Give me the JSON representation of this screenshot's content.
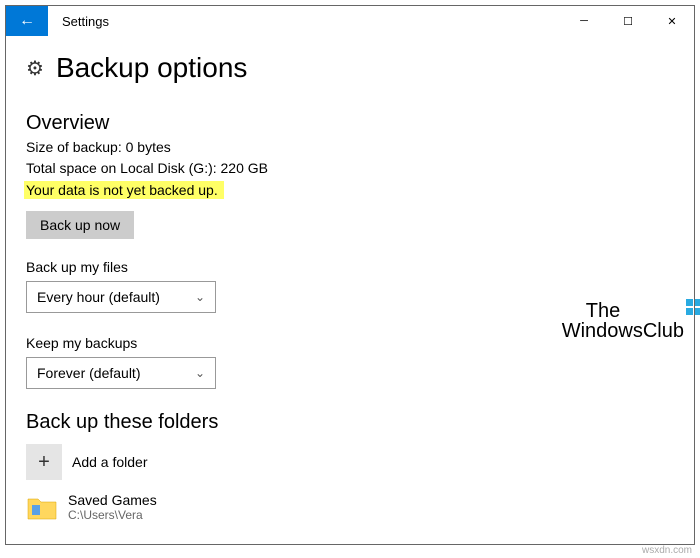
{
  "window": {
    "title": "Settings"
  },
  "header": {
    "page_title": "Backup options"
  },
  "overview": {
    "heading": "Overview",
    "size_line": "Size of backup: 0 bytes",
    "space_line": "Total space on Local Disk (G:): 220 GB",
    "status_highlight": "Your data is not yet backed up.",
    "backup_now_label": "Back up now"
  },
  "frequency": {
    "label": "Back up my files",
    "selected": "Every hour (default)"
  },
  "retention": {
    "label": "Keep my backups",
    "selected": "Forever (default)"
  },
  "folders": {
    "heading": "Back up these folders",
    "add_label": "Add a folder",
    "items": [
      {
        "name": "Saved Games",
        "path": "C:\\Users\\Vera"
      }
    ]
  },
  "watermark": {
    "line1": "The",
    "line2": "WindowsClub"
  },
  "attribution": "wsxdn.com"
}
